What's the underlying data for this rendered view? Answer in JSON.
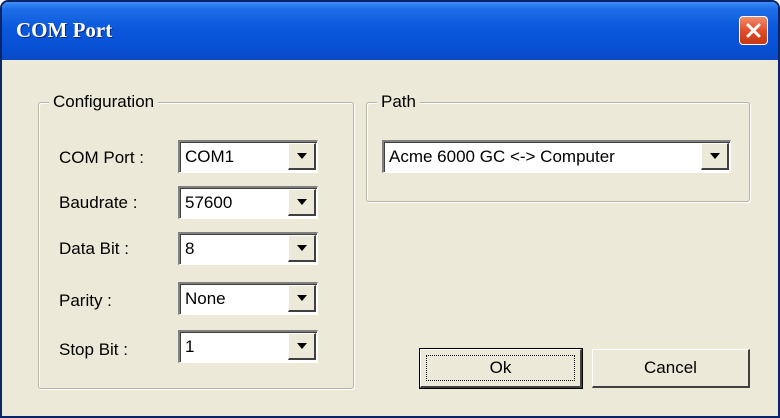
{
  "window": {
    "title": "COM Port"
  },
  "icons": {
    "close": "close-icon",
    "dropdown": "chevron-down-icon"
  },
  "colors": {
    "titlebar": "#0a58dc",
    "close_button": "#e0502a",
    "dialog_bg": "#ece9d8"
  },
  "configuration": {
    "legend": "Configuration",
    "com_port": {
      "label": "COM Port :",
      "value": "COM1"
    },
    "baudrate": {
      "label": "Baudrate :",
      "value": "57600"
    },
    "data_bit": {
      "label": "Data Bit :",
      "value": "8"
    },
    "parity": {
      "label": "Parity :",
      "value": "None"
    },
    "stop_bit": {
      "label": "Stop Bit :",
      "value": "1"
    }
  },
  "path": {
    "legend": "Path",
    "value": "Acme 6000 GC <-> Computer"
  },
  "buttons": {
    "ok": "Ok",
    "cancel": "Cancel"
  }
}
